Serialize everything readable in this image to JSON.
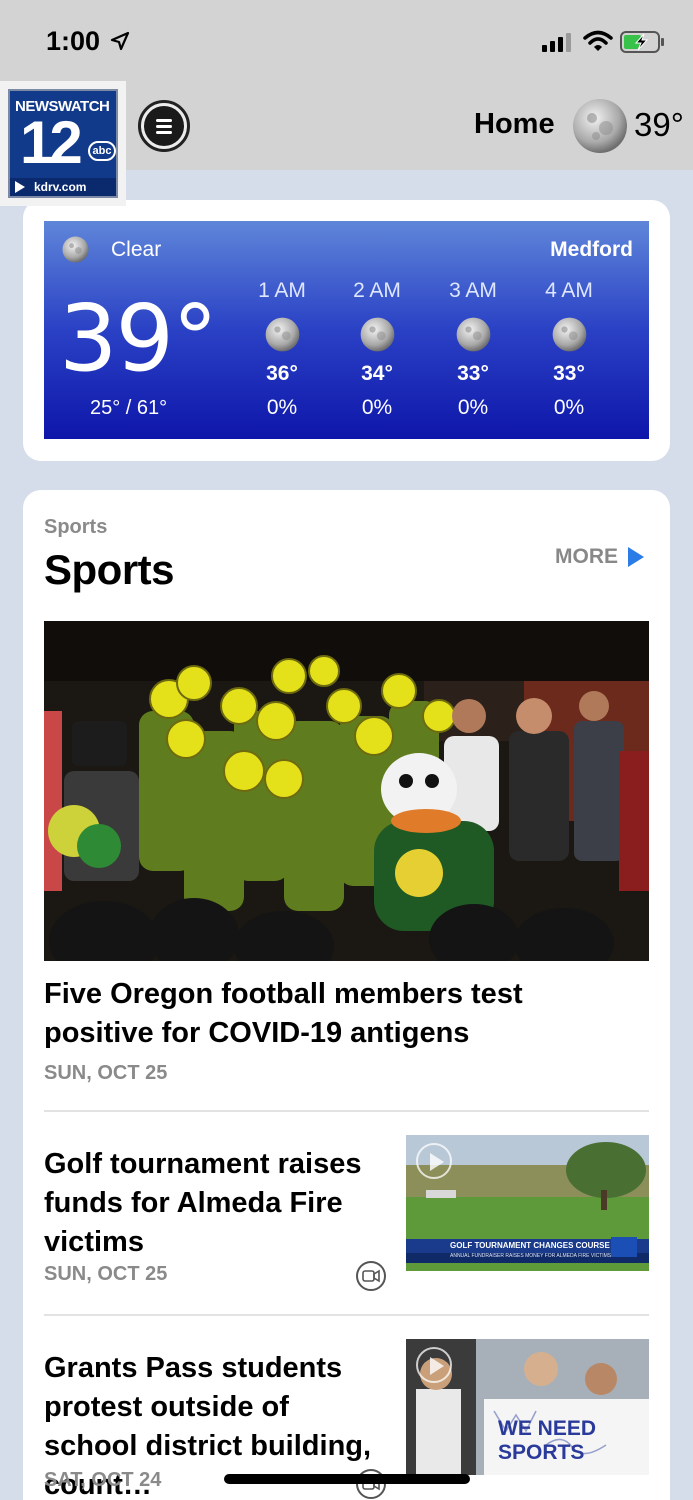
{
  "status_bar": {
    "time": "1:00"
  },
  "header": {
    "logo_name": "NEWSWATCH",
    "logo_number": "12",
    "logo_network": "abc",
    "logo_url": "kdrv.com",
    "home_label": "Home",
    "temp": "39°"
  },
  "weather": {
    "condition": "Clear",
    "city": "Medford",
    "current_temp": "39°",
    "range": "25° / 61°",
    "hourly": [
      {
        "time": "1 AM",
        "temp": "36°",
        "precip": "0%"
      },
      {
        "time": "2 AM",
        "temp": "34°",
        "precip": "0%"
      },
      {
        "time": "3 AM",
        "temp": "33°",
        "precip": "0%"
      },
      {
        "time": "4 AM",
        "temp": "33°",
        "precip": "0%"
      }
    ]
  },
  "sports": {
    "eyebrow": "Sports",
    "title": "Sports",
    "more_label": "MORE",
    "hero": {
      "title": "Five Oregon football members test positive for COVID-19 antigens",
      "date": "SUN, OCT 25"
    },
    "stories": [
      {
        "title": "Golf tournament raises funds for Almeda Fire victims",
        "date": "SUN, OCT 25",
        "thumb_caption": "GOLF TOURNAMENT CHANGES COURSE",
        "thumb_subcaption": "ANNUAL FUNDRAISER RAISES MONEY FOR ALMEDA FIRE VICTIMS"
      },
      {
        "title": "Grants Pass students protest outside of school district building, count…",
        "date": "SAT, OCT 24",
        "thumb_sign_text": "WE NEED SPORTS"
      }
    ]
  },
  "colors": {
    "accent": "#2c7ce8",
    "weather_top": "#5f86d9",
    "weather_bottom": "#0e16aa",
    "muted_text": "#8a8a8a"
  },
  "icons": [
    "location-arrow-icon",
    "signal-icon",
    "wifi-icon",
    "battery-charging-icon",
    "menu-icon",
    "moon-icon",
    "more-arrow-icon",
    "video-icon",
    "play-icon"
  ]
}
